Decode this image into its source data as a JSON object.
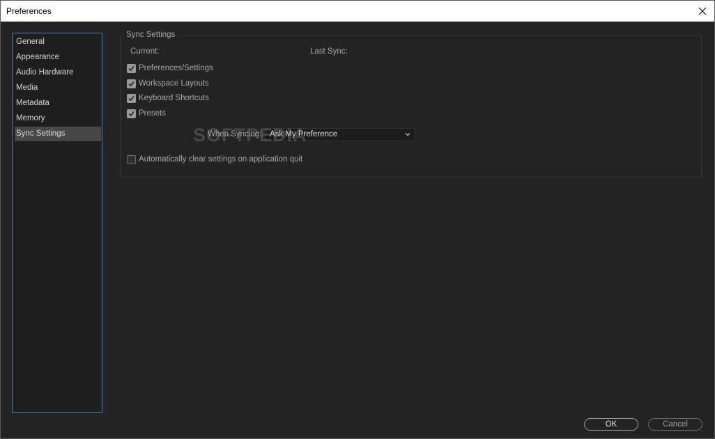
{
  "window": {
    "title": "Preferences"
  },
  "sidebar": {
    "items": [
      {
        "label": "General",
        "selected": false
      },
      {
        "label": "Appearance",
        "selected": false
      },
      {
        "label": "Audio Hardware",
        "selected": false
      },
      {
        "label": "Media",
        "selected": false
      },
      {
        "label": "Metadata",
        "selected": false
      },
      {
        "label": "Memory",
        "selected": false
      },
      {
        "label": "Sync Settings",
        "selected": true
      }
    ]
  },
  "sync": {
    "group_title": "Sync Settings",
    "current_label": "Current:",
    "last_sync_label": "Last Sync:",
    "options": [
      {
        "label": "Preferences/Settings",
        "checked": true
      },
      {
        "label": "Workspace Layouts",
        "checked": true
      },
      {
        "label": "Keyboard Shortcuts",
        "checked": true
      },
      {
        "label": "Presets",
        "checked": true
      }
    ],
    "when_syncing_label": "When Syncing:",
    "when_syncing_value": "Ask My Preference",
    "auto_clear_label": "Automatically clear settings on application quit",
    "auto_clear_checked": false
  },
  "watermark": "SOFTPEDIA",
  "footer": {
    "ok_label": "OK",
    "cancel_label": "Cancel"
  },
  "icons": {
    "close": "close-icon",
    "check": "check-icon",
    "chevron": "chevron-down-icon"
  },
  "colors": {
    "accent": "#4f80c9",
    "background": "#232323",
    "selected": "#474747"
  }
}
